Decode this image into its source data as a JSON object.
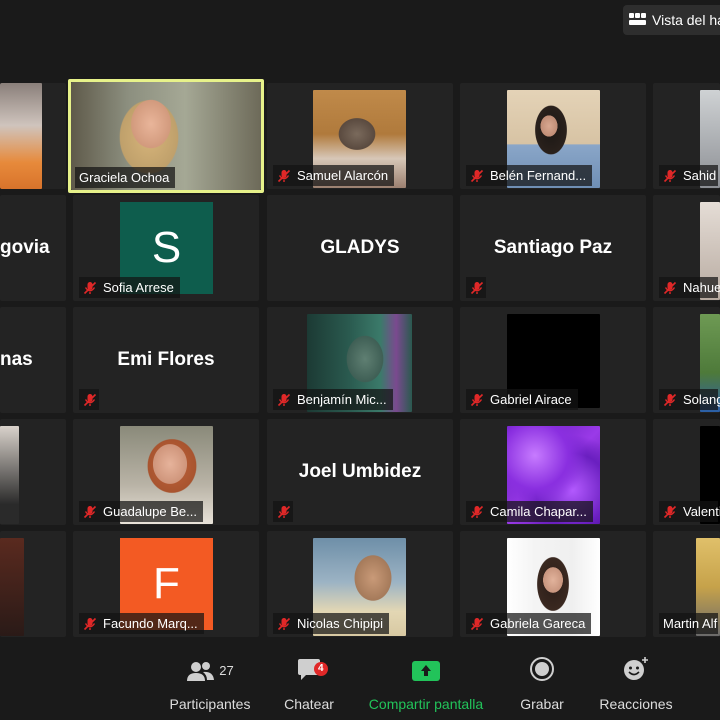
{
  "header": {
    "view_button_label": "Vista del ha"
  },
  "grid": {
    "row1": {
      "t0": {
        "name": ""
      },
      "t1": {
        "name": "Graciela Ochoa"
      },
      "t2": {
        "name": "Samuel Alarcón"
      },
      "t3": {
        "name": "Belén Fernand..."
      },
      "t4": {
        "name": "Sahid I"
      }
    },
    "row2": {
      "t0": {
        "display": "govia"
      },
      "t1": {
        "initial": "S",
        "name": "Sofia Arrese"
      },
      "t2": {
        "display": "GLADYS"
      },
      "t3": {
        "display": "Santiago Paz"
      },
      "t4": {
        "name": "Nahue"
      }
    },
    "row3": {
      "t0": {
        "display": "nas"
      },
      "t1": {
        "display": "Emi Flores"
      },
      "t2": {
        "name": "Benjamín Mic..."
      },
      "t3": {
        "name": "Gabriel Airace"
      },
      "t4": {
        "name": "Solang"
      }
    },
    "row4": {
      "t1": {
        "name": "Guadalupe Be..."
      },
      "t2": {
        "display": "Joel Umbidez"
      },
      "t3": {
        "name": "Camila Chapar..."
      },
      "t4": {
        "name": "Valenti"
      }
    },
    "row5": {
      "t1": {
        "initial": "F",
        "name": "Facundo Marq..."
      },
      "t2": {
        "name": "Nicolas Chipipi"
      },
      "t3": {
        "name": "Gabriela Gareca"
      },
      "t4": {
        "name": "Martin Alf"
      }
    }
  },
  "toolbar": {
    "participants": {
      "label": "Participantes",
      "count": "27"
    },
    "chat": {
      "label": "Chatear",
      "badge": "4"
    },
    "share": {
      "label": "Compartir pantalla"
    },
    "record": {
      "label": "Grabar"
    },
    "reactions": {
      "label": "Reacciones"
    }
  },
  "colors": {
    "active_speaker_border": "#e7f28a",
    "mute_icon": "#e02828",
    "share_green": "#22c35a",
    "avatar_s": "#0e5d4d",
    "avatar_f": "#f35a23"
  }
}
